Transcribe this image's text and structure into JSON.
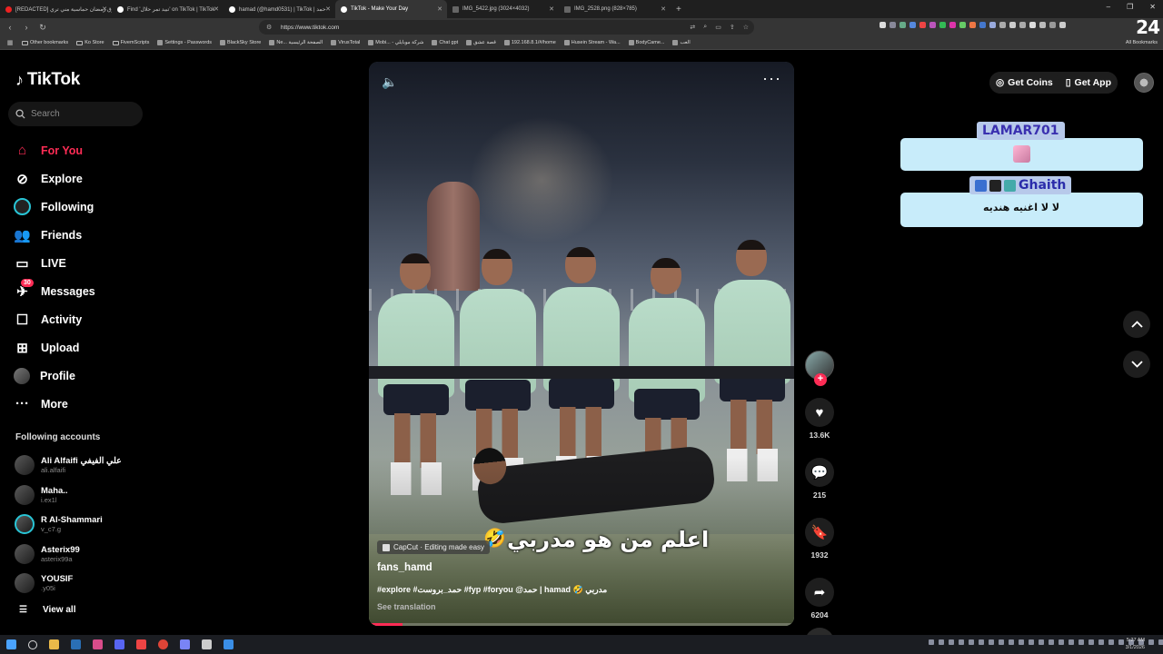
{
  "browser": {
    "tabs": [
      {
        "title": "[REDACTED] فلوق رمضان حماسية مني تري",
        "favicon": "yt",
        "active": false
      },
      {
        "title": "Find 'تبيد تمر حلال' on TikTok | TikTok",
        "favicon": "tt",
        "active": false
      },
      {
        "title": "hamad (@hamd0531) | TikTok | حمد",
        "favicon": "tt",
        "active": false
      },
      {
        "title": "TikTok - Make Your Day",
        "favicon": "tt",
        "active": true
      },
      {
        "title": "IMG_5422.jpg (3024×4032)",
        "favicon": "img",
        "active": false
      },
      {
        "title": "IMG_2528.png (828×785)",
        "favicon": "img",
        "active": false
      }
    ],
    "url": "https://www.tiktok.com",
    "bookmarks": [
      "Other bookmarks",
      "Ko Store",
      "FivemScripts",
      "Settings - Passwords",
      "BlackSky Store",
      "Ne... الصفحة الرئيسية",
      "VirusTotal",
      "Mobi... - شركة موبايلي",
      "Chat gpt",
      "قصة عشق",
      "192.168.8.1/#/home",
      "Husein Stream - Wa...",
      "BodyCame...",
      "العب"
    ],
    "all_bookmarks": "All Bookmarks",
    "clock_overlay": "24"
  },
  "sidebar": {
    "brand": "TikTok",
    "search_placeholder": "Search",
    "nav": [
      {
        "label": "For You",
        "icon": "home-icon",
        "active": true
      },
      {
        "label": "Explore",
        "icon": "compass-icon",
        "active": false
      },
      {
        "label": "Following",
        "icon": "following-avatar-icon",
        "active": false
      },
      {
        "label": "Friends",
        "icon": "friends-icon",
        "active": false
      },
      {
        "label": "LIVE",
        "icon": "live-icon",
        "active": false
      },
      {
        "label": "Messages",
        "icon": "messages-icon",
        "active": false,
        "badge": "30"
      },
      {
        "label": "Activity",
        "icon": "activity-icon",
        "active": false
      },
      {
        "label": "Upload",
        "icon": "upload-icon",
        "active": false
      },
      {
        "label": "Profile",
        "icon": "profile-avatar-icon",
        "active": false
      },
      {
        "label": "More",
        "icon": "more-icon",
        "active": false
      }
    ],
    "following_heading": "Following accounts",
    "following": [
      {
        "name": "Ali Alfaifi علي الفيفي",
        "handle": "ali.alfaifi"
      },
      {
        "name": "Maha..",
        "handle": "i.ex1l"
      },
      {
        "name": "R Al-Shammari",
        "handle": "v_c7.g"
      },
      {
        "name": "Asterix99",
        "handle": "asterix99a"
      },
      {
        "name": "YOUSIF",
        "handle": ".y05i"
      }
    ],
    "view_all": "View all"
  },
  "video": {
    "overlay_text": "اعلم من هو مدربي",
    "capcut_label": "CapCut · Editing made easy",
    "author": "fans_hamd",
    "caption": "#explore #حمد_بروست #fyp #foryou @حمد | hamad 🤣 مدربي",
    "see_translation": "See translation",
    "progress": 0.08
  },
  "actions": {
    "likes": "13.6K",
    "comments": "215",
    "saves": "1932",
    "shares": "6204"
  },
  "topbar": {
    "get_coins": "Get Coins",
    "get_app": "Get App"
  },
  "chat_overlay": {
    "user1": "LAMAR701",
    "user2": "Ghaith",
    "message2": "لا لا اغنيه هنديه"
  },
  "taskbar": {
    "time": "5:27 AM",
    "date": "3/1/2026"
  }
}
